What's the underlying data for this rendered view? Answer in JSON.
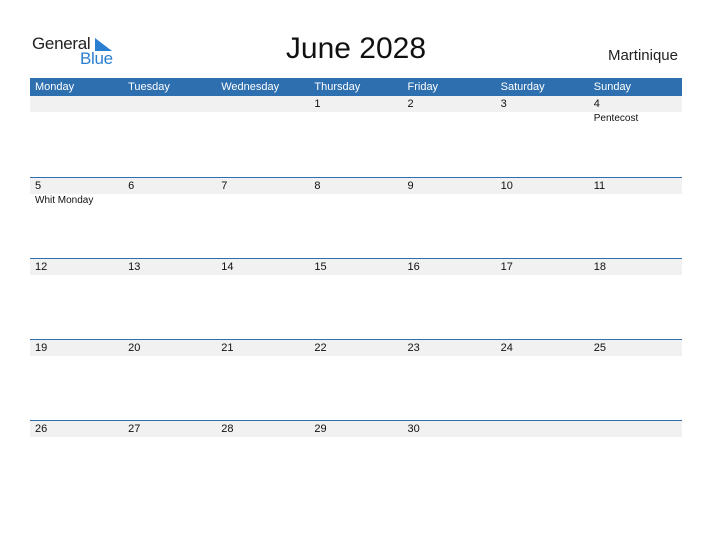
{
  "logo": {
    "general": "General",
    "blue": "Blue",
    "accent": "#2a7fd0"
  },
  "title": "June 2028",
  "country": "Martinique",
  "colors": {
    "header_bg": "#2e6fb0",
    "date_strip_bg": "#f1f1f1"
  },
  "weekdays": [
    "Monday",
    "Tuesday",
    "Wednesday",
    "Thursday",
    "Friday",
    "Saturday",
    "Sunday"
  ],
  "weeks": [
    {
      "days": [
        "",
        "",
        "",
        "1",
        "2",
        "3",
        "4"
      ],
      "events": [
        "",
        "",
        "",
        "",
        "",
        "",
        "Pentecost"
      ]
    },
    {
      "days": [
        "5",
        "6",
        "7",
        "8",
        "9",
        "10",
        "11"
      ],
      "events": [
        "Whit Monday",
        "",
        "",
        "",
        "",
        "",
        ""
      ]
    },
    {
      "days": [
        "12",
        "13",
        "14",
        "15",
        "16",
        "17",
        "18"
      ],
      "events": [
        "",
        "",
        "",
        "",
        "",
        "",
        ""
      ]
    },
    {
      "days": [
        "19",
        "20",
        "21",
        "22",
        "23",
        "24",
        "25"
      ],
      "events": [
        "",
        "",
        "",
        "",
        "",
        "",
        ""
      ]
    },
    {
      "days": [
        "26",
        "27",
        "28",
        "29",
        "30",
        "",
        ""
      ],
      "events": [
        "",
        "",
        "",
        "",
        "",
        "",
        ""
      ]
    }
  ]
}
